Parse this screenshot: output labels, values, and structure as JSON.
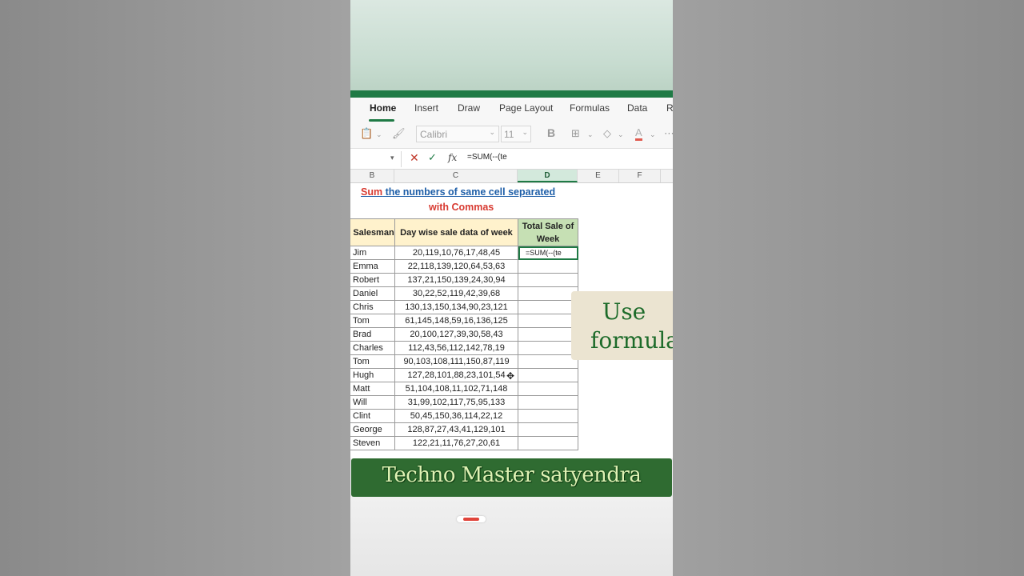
{
  "ribbon": {
    "tabs": [
      "Home",
      "Insert",
      "Draw",
      "Page Layout",
      "Formulas",
      "Data",
      "R"
    ],
    "font_name": "Calibri",
    "font_size": "11",
    "bold_label": "B",
    "font_color_label": "A"
  },
  "formula_bar": {
    "cancel": "✕",
    "enter": "✓",
    "fx": "fx",
    "content": "=SUM(--(te"
  },
  "columns": [
    "B",
    "C",
    "D",
    "E",
    "F"
  ],
  "sheet": {
    "title_sum": "Sum",
    "title_rest": " the numbers of same cell separated",
    "title_line2": "with Commas",
    "headers": [
      "Salesman",
      "Day wise sale data of week",
      "Total Sale of Week"
    ],
    "rows": [
      {
        "name": "Jim",
        "data": "20,119,10,76,17,48,45",
        "total": "=SUM(--(te"
      },
      {
        "name": "Emma",
        "data": "22,118,139,120,64,53,63",
        "total": ""
      },
      {
        "name": "Robert",
        "data": "137,21,150,139,24,30,94",
        "total": ""
      },
      {
        "name": "Daniel",
        "data": "30,22,52,119,42,39,68",
        "total": ""
      },
      {
        "name": "Chris",
        "data": "130,13,150,134,90,23,121",
        "total": ""
      },
      {
        "name": "Tom",
        "data": "61,145,148,59,16,136,125",
        "total": ""
      },
      {
        "name": "Brad",
        "data": "20,100,127,39,30,58,43",
        "total": ""
      },
      {
        "name": "Charles",
        "data": "112,43,56,112,142,78,19",
        "total": ""
      },
      {
        "name": "Tom",
        "data": "90,103,108,111,150,87,119",
        "total": ""
      },
      {
        "name": "Hugh",
        "data": "127,28,101,88,23,101,54",
        "total": ""
      },
      {
        "name": "Matt",
        "data": "51,104,108,11,102,71,148",
        "total": ""
      },
      {
        "name": "Will",
        "data": "31,99,102,117,75,95,133",
        "total": ""
      },
      {
        "name": "Clint",
        "data": "50,45,150,36,114,22,12",
        "total": ""
      },
      {
        "name": "George",
        "data": "128,87,27,43,41,129,101",
        "total": ""
      },
      {
        "name": "Steven",
        "data": "122,21,11,76,27,20,61",
        "total": ""
      }
    ]
  },
  "overlay": {
    "use_line1": "Use",
    "use_line2": "formula",
    "banner": "Techno Master satyendra"
  },
  "colors": {
    "excel_green": "#1f7a45",
    "header_yellow": "#fff2cc",
    "header_green": "#c6e0b4",
    "banner_green": "#2f6b31"
  }
}
